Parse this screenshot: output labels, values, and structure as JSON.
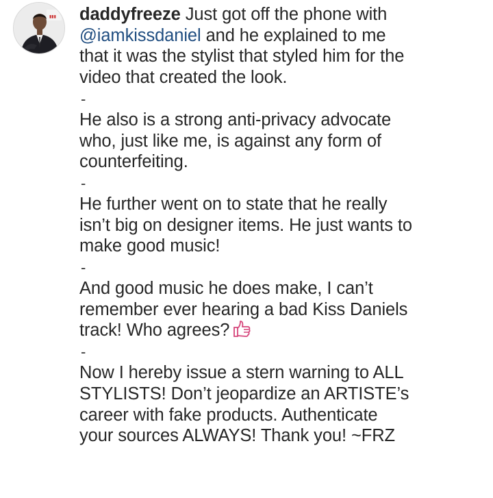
{
  "post": {
    "username": "daddyfreeze",
    "mention": "@iamkissdaniel",
    "emoji_icon": "thumbs-up-icon",
    "separator": "-",
    "lines": {
      "p1_l1": "Just got off the phone with",
      "p1_l2": "and he explained to me",
      "p1_l3": "that it was the stylist that styled him for the",
      "p1_l4": "video that created the look.",
      "p2_l1": "He also is a strong anti-privacy advocate",
      "p2_l2": "who, just like me, is against any form of",
      "p2_l3": "counterfeiting.",
      "p3_l1": "He further went on to state that he really",
      "p3_l2": "isn’t big on designer items. He just wants to",
      "p3_l3": "make good music!",
      "p4_l1": "And good music he does make, I can’t",
      "p4_l2": "remember ever hearing a bad Kiss Daniels",
      "p4_l3": "track! Who agrees?",
      "p5_l1": "Now I hereby issue a stern warning to ALL",
      "p5_l2": "STYLISTS! Don’t jeopardize an ARTISTE’s",
      "p5_l3": "career with fake products. Authenticate",
      "p5_l4": "your sources ALWAYS! Thank you! ~FRZ"
    }
  },
  "colors": {
    "text": "#262626",
    "mention": "#1f4d80",
    "emoji": "#d6447a"
  }
}
